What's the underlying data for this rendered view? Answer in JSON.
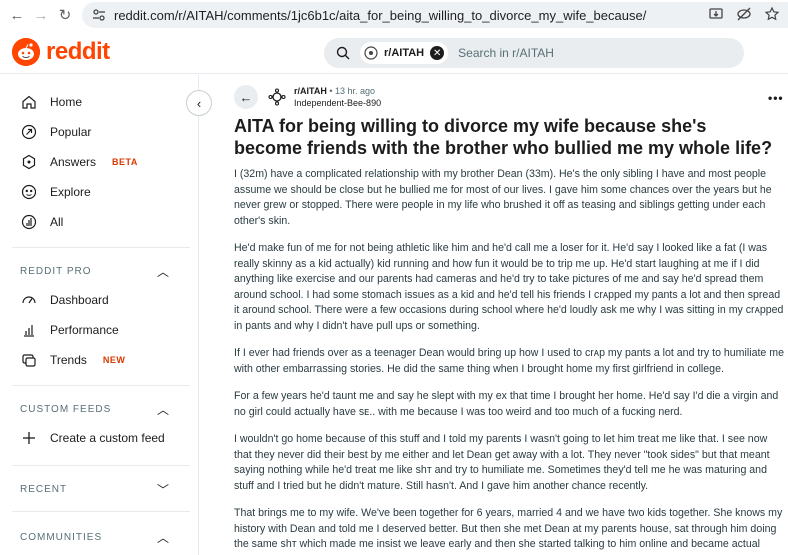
{
  "browser": {
    "url": "reddit.com/r/AITAH/comments/1jc6b1c/aita_for_being_willing_to_divorce_my_wife_because/"
  },
  "header": {
    "logo_text": "reddit",
    "search_chip": "r/AITAH",
    "search_placeholder": "Search in r/AITAH"
  },
  "sidebar": {
    "nav": [
      {
        "label": "Home",
        "icon": "home-icon"
      },
      {
        "label": "Popular",
        "icon": "popular-icon"
      },
      {
        "label": "Answers",
        "badge": "BETA",
        "icon": "answers-icon"
      },
      {
        "label": "Explore",
        "icon": "explore-icon"
      },
      {
        "label": "All",
        "icon": "all-icon"
      }
    ],
    "reddit_pro": {
      "title": "REDDIT PRO",
      "items": [
        {
          "label": "Dashboard",
          "icon": "dashboard-icon"
        },
        {
          "label": "Performance",
          "icon": "performance-icon"
        },
        {
          "label": "Trends",
          "badge": "NEW",
          "icon": "trends-icon"
        }
      ]
    },
    "custom_feeds": {
      "title": "CUSTOM FEEDS",
      "create_label": "Create a custom feed"
    },
    "recent_title": "RECENT",
    "communities_title": "COMMUNITIES"
  },
  "post": {
    "subreddit": "r/AITAH",
    "time": "• 13 hr. ago",
    "author": "Independent-Bee-890",
    "title": "AITA for being willing to divorce my wife because she's become friends with the brother who bullied me my whole life?",
    "paragraphs": [
      "I (32m) have a complicated relationship with my brother Dean (33m). He's the only sibling I have and most people assume we should be close but he bullied me for most of our lives. I gave him some chances over the years but he never grew or stopped. There were people in my life who brushed it off as teasing and siblings getting under each other's skin.",
      "He'd make fun of me for not being athletic like him and he'd call me a loser for it. He'd say I looked like a fat (I was really skinny as a kid actually) kid running and how fun it would be to trip me up. He'd start laughing at me if I did anything like exercise and our parents had cameras and he'd try to take pictures of me and say he'd spread them around school. I had some stomach issues as a kid and he'd tell his friends I crᴀpped my pants a lot and then spread it around school. There were a few occasions during school where he'd loudly ask me why I was sitting in my crᴀpped in pants and why I didn't have pull ups or something.",
      "If I ever had friends over as a teenager Dean would bring up how I used to crᴀp my pants a lot and try to humiliate me with other embarrassing stories. He did the same thing when I brought home my first girlfriend in college.",
      "For a few years he'd taunt me and say he slept with my ex that time I brought her home. He'd say I'd die a virgin and no girl could actually have sᴇ.. with me because I was too weird and too much of a fᴜᴄᴋing nerd.",
      "I wouldn't go home because of this stuff and I told my parents I wasn't going to let him treat me like that. I see now that they never did their best by me either and let Dean get away with a lot. They never \"took sides\" but that meant saying nothing while he'd treat me like shᴛ and try to humiliate me. Sometimes they'd tell me he was maturing and stuff and I tried but he didn't mature. Still hasn't. And I gave him another chance recently.",
      "That brings me to my wife. We've been together for 6 years, married 4 and we have two kids together. She knows my history with Dean and told me I deserved better. But then she met Dean at my parents house, sat through him doing the same shᴛ which made me insist we leave early and then she started talking to him online and became actual friends with him. They text and make plans and I'm so hurt by that. She told me I don't get to police her"
    ]
  },
  "colors": {
    "brand": "#ff4500",
    "badge": "#d93900",
    "text": "#1c1c1c",
    "muted": "#576f76"
  }
}
